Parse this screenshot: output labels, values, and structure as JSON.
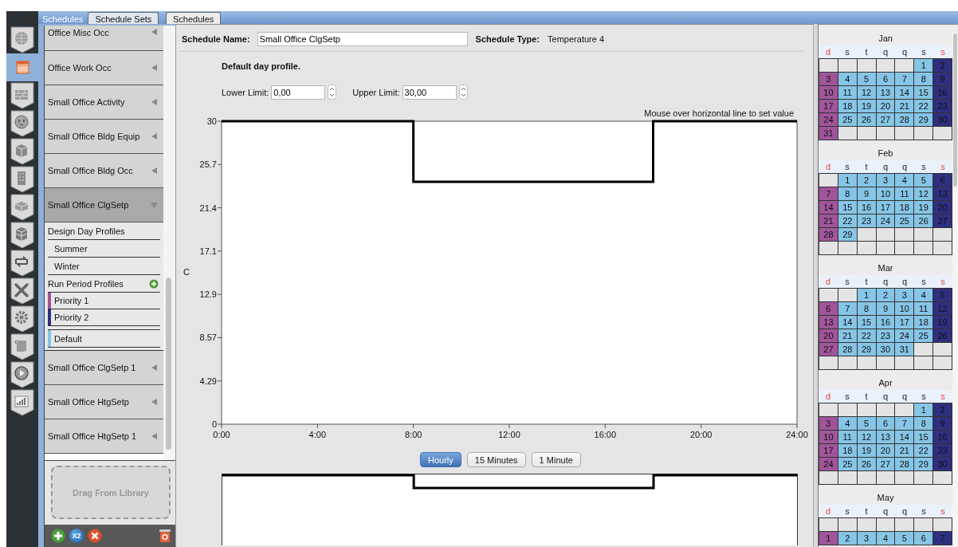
{
  "nav_items": [
    {
      "selected": false
    },
    {
      "selected": true
    },
    {
      "selected": false
    },
    {
      "selected": false
    },
    {
      "selected": false
    },
    {
      "selected": false
    },
    {
      "selected": false
    },
    {
      "selected": false
    },
    {
      "selected": false
    },
    {
      "selected": false
    },
    {
      "selected": false
    },
    {
      "selected": false
    },
    {
      "selected": false
    },
    {
      "selected": false
    }
  ],
  "library_tabs": [
    {
      "label": "Schedules",
      "selected": true
    },
    {
      "label": "Schedule Sets",
      "selected": false
    }
  ],
  "main_tabs": [
    {
      "label": "Schedules",
      "selected": true
    }
  ],
  "schedules": [
    {
      "label": "Office Misc Occ",
      "expanded": false
    },
    {
      "label": "Office Work Occ",
      "expanded": false
    },
    {
      "label": "Small Office Activity",
      "expanded": false
    },
    {
      "label": "Small Office Bldg Equip",
      "expanded": false
    },
    {
      "label": "Small Office Bldg Occ",
      "expanded": false
    },
    {
      "label": "Small Office ClgSetp",
      "expanded": true,
      "design_day_profiles": {
        "title": "Design Day Profiles",
        "items": [
          {
            "label": "Summer"
          },
          {
            "label": "Winter"
          }
        ]
      },
      "run_period_profiles": {
        "title": "Run Period Profiles",
        "items": [
          {
            "label": "Priority 1",
            "kind": "rule",
            "color": "#a0559b"
          },
          {
            "label": "Priority 2",
            "kind": "rule",
            "color": "#2e2f7f"
          },
          {
            "label": "Default",
            "kind": "default",
            "color": "#86c5e6"
          }
        ]
      }
    },
    {
      "label": "Small Office ClgSetp 1",
      "expanded": false
    },
    {
      "label": "Small Office HtgSetp",
      "expanded": false
    },
    {
      "label": "Small Office HtgSetp 1",
      "expanded": false
    }
  ],
  "drag_area": {
    "label": "Drag From Library"
  },
  "library_toolbar": {
    "duplicate_label": "X2"
  },
  "schedule_name": {
    "label": "Schedule Name:",
    "value": "Small Office ClgSetp"
  },
  "schedule_type": {
    "label": "Schedule Type:",
    "value": "Temperature 4"
  },
  "day_profile_title": "Default day profile.",
  "lower_limit": {
    "label": "Lower Limit:",
    "value": "0,00"
  },
  "upper_limit": {
    "label": "Upper Limit:",
    "value": "30,00"
  },
  "chart_hint": "Mouse over horizontal line to set value",
  "chart_data": {
    "type": "line",
    "ylabel": "C",
    "x": [
      0,
      8,
      8,
      18,
      18,
      24
    ],
    "series": [
      {
        "color": "#000000",
        "values": [
          30,
          30,
          24,
          24,
          30,
          30
        ]
      }
    ],
    "xlim": [
      0,
      24
    ],
    "ylim": [
      0,
      30
    ],
    "xticks": [
      {
        "value": 0,
        "label": "0:00"
      },
      {
        "value": 4,
        "label": "4:00"
      },
      {
        "value": 8,
        "label": "8:00"
      },
      {
        "value": 12,
        "label": "12:00"
      },
      {
        "value": 16,
        "label": "16:00"
      },
      {
        "value": 20,
        "label": "20:00"
      },
      {
        "value": 24,
        "label": "24:00"
      }
    ],
    "yticks": [
      0,
      {
        "value": 4.2857,
        "label": "4.29"
      },
      {
        "value": 8.5714,
        "label": "8.57"
      },
      {
        "value": 12.857,
        "label": "12.9"
      },
      {
        "value": 17.143,
        "label": "17.1"
      },
      {
        "value": 21.429,
        "label": "21.4"
      },
      {
        "value": 25.714,
        "label": "25.7"
      },
      30
    ]
  },
  "resolution_buttons": [
    {
      "label": "Hourly",
      "selected": true
    },
    {
      "label": "15 Minutes",
      "selected": false
    },
    {
      "label": "1 Minute",
      "selected": false
    }
  ],
  "calendar": {
    "months": [
      {
        "name": "Jan",
        "weekdays": [
          {
            "label": "d",
            "weekend": true
          },
          {
            "label": "s",
            "weekend": false
          },
          {
            "label": "t",
            "weekend": false
          },
          {
            "label": "q",
            "weekend": false
          },
          {
            "label": "q",
            "weekend": false
          },
          {
            "label": "s",
            "weekend": false
          },
          {
            "label": "s",
            "weekend": true
          }
        ],
        "weeks": [
          [
            {
              "kind": "blank"
            },
            {
              "kind": "blank"
            },
            {
              "kind": "blank"
            },
            {
              "kind": "blank"
            },
            {
              "kind": "blank"
            },
            {
              "kind": "day",
              "day": "1",
              "color": "#86c5e6"
            },
            {
              "kind": "day",
              "day": "2",
              "color": "#2e2f7f"
            }
          ],
          [
            {
              "kind": "day",
              "day": "3",
              "color": "#a0559b"
            },
            {
              "kind": "day",
              "day": "4",
              "color": "#86c5e6"
            },
            {
              "kind": "day",
              "day": "5",
              "color": "#86c5e6"
            },
            {
              "kind": "day",
              "day": "6",
              "color": "#86c5e6"
            },
            {
              "kind": "day",
              "day": "7",
              "color": "#86c5e6"
            },
            {
              "kind": "day",
              "day": "8",
              "color": "#86c5e6"
            },
            {
              "kind": "day",
              "day": "9",
              "color": "#2e2f7f"
            }
          ],
          [
            {
              "kind": "day",
              "day": "10",
              "color": "#a0559b"
            },
            {
              "kind": "day",
              "day": "11",
              "color": "#86c5e6"
            },
            {
              "kind": "day",
              "day": "12",
              "color": "#86c5e6"
            },
            {
              "kind": "day",
              "day": "13",
              "color": "#86c5e6"
            },
            {
              "kind": "day",
              "day": "14",
              "color": "#86c5e6"
            },
            {
              "kind": "day",
              "day": "15",
              "color": "#86c5e6"
            },
            {
              "kind": "day",
              "day": "16",
              "color": "#2e2f7f"
            }
          ],
          [
            {
              "kind": "day",
              "day": "17",
              "color": "#a0559b"
            },
            {
              "kind": "day",
              "day": "18",
              "color": "#86c5e6"
            },
            {
              "kind": "day",
              "day": "19",
              "color": "#86c5e6"
            },
            {
              "kind": "day",
              "day": "20",
              "color": "#86c5e6"
            },
            {
              "kind": "day",
              "day": "21",
              "color": "#86c5e6"
            },
            {
              "kind": "day",
              "day": "22",
              "color": "#86c5e6"
            },
            {
              "kind": "day",
              "day": "23",
              "color": "#2e2f7f"
            }
          ],
          [
            {
              "kind": "day",
              "day": "24",
              "color": "#a0559b"
            },
            {
              "kind": "day",
              "day": "25",
              "color": "#86c5e6"
            },
            {
              "kind": "day",
              "day": "26",
              "color": "#86c5e6"
            },
            {
              "kind": "day",
              "day": "27",
              "color": "#86c5e6"
            },
            {
              "kind": "day",
              "day": "28",
              "color": "#86c5e6"
            },
            {
              "kind": "day",
              "day": "29",
              "color": "#86c5e6"
            },
            {
              "kind": "day",
              "day": "30",
              "color": "#2e2f7f"
            }
          ],
          [
            {
              "kind": "day",
              "day": "31",
              "color": "#a0559b"
            },
            {
              "kind": "blank"
            },
            {
              "kind": "blank"
            },
            {
              "kind": "blank"
            },
            {
              "kind": "blank"
            },
            {
              "kind": "blank"
            },
            {
              "kind": "blank"
            }
          ]
        ]
      },
      {
        "name": "Feb",
        "weekdays": [
          {
            "label": "d",
            "weekend": true
          },
          {
            "label": "s",
            "weekend": false
          },
          {
            "label": "t",
            "weekend": false
          },
          {
            "label": "q",
            "weekend": false
          },
          {
            "label": "q",
            "weekend": false
          },
          {
            "label": "s",
            "weekend": false
          },
          {
            "label": "s",
            "weekend": true
          }
        ],
        "weeks": [
          [
            {
              "kind": "blank"
            },
            {
              "kind": "day",
              "day": "1",
              "color": "#86c5e6"
            },
            {
              "kind": "day",
              "day": "2",
              "color": "#86c5e6"
            },
            {
              "kind": "day",
              "day": "3",
              "color": "#86c5e6"
            },
            {
              "kind": "day",
              "day": "4",
              "color": "#86c5e6"
            },
            {
              "kind": "day",
              "day": "5",
              "color": "#86c5e6"
            },
            {
              "kind": "day",
              "day": "6",
              "color": "#2e2f7f"
            }
          ],
          [
            {
              "kind": "day",
              "day": "7",
              "color": "#a0559b"
            },
            {
              "kind": "day",
              "day": "8",
              "color": "#86c5e6"
            },
            {
              "kind": "day",
              "day": "9",
              "color": "#86c5e6"
            },
            {
              "kind": "day",
              "day": "10",
              "color": "#86c5e6"
            },
            {
              "kind": "day",
              "day": "11",
              "color": "#86c5e6"
            },
            {
              "kind": "day",
              "day": "12",
              "color": "#86c5e6"
            },
            {
              "kind": "day",
              "day": "13",
              "color": "#2e2f7f"
            }
          ],
          [
            {
              "kind": "day",
              "day": "14",
              "color": "#a0559b"
            },
            {
              "kind": "day",
              "day": "15",
              "color": "#86c5e6"
            },
            {
              "kind": "day",
              "day": "16",
              "color": "#86c5e6"
            },
            {
              "kind": "day",
              "day": "17",
              "color": "#86c5e6"
            },
            {
              "kind": "day",
              "day": "18",
              "color": "#86c5e6"
            },
            {
              "kind": "day",
              "day": "19",
              "color": "#86c5e6"
            },
            {
              "kind": "day",
              "day": "20",
              "color": "#2e2f7f"
            }
          ],
          [
            {
              "kind": "day",
              "day": "21",
              "color": "#a0559b"
            },
            {
              "kind": "day",
              "day": "22",
              "color": "#86c5e6"
            },
            {
              "kind": "day",
              "day": "23",
              "color": "#86c5e6"
            },
            {
              "kind": "day",
              "day": "24",
              "color": "#86c5e6"
            },
            {
              "kind": "day",
              "day": "25",
              "color": "#86c5e6"
            },
            {
              "kind": "day",
              "day": "26",
              "color": "#86c5e6"
            },
            {
              "kind": "day",
              "day": "27",
              "color": "#2e2f7f"
            }
          ],
          [
            {
              "kind": "day",
              "day": "28",
              "color": "#a0559b"
            },
            {
              "kind": "day",
              "day": "29",
              "color": "#86c5e6"
            },
            {
              "kind": "blank"
            },
            {
              "kind": "blank"
            },
            {
              "kind": "blank"
            },
            {
              "kind": "blank"
            },
            {
              "kind": "blank"
            }
          ],
          [
            {
              "kind": "blank"
            },
            {
              "kind": "blank"
            },
            {
              "kind": "blank"
            },
            {
              "kind": "blank"
            },
            {
              "kind": "blank"
            },
            {
              "kind": "blank"
            },
            {
              "kind": "blank"
            }
          ]
        ]
      },
      {
        "name": "Mar",
        "weekdays": [
          {
            "label": "d",
            "weekend": true
          },
          {
            "label": "s",
            "weekend": false
          },
          {
            "label": "t",
            "weekend": false
          },
          {
            "label": "q",
            "weekend": false
          },
          {
            "label": "q",
            "weekend": false
          },
          {
            "label": "s",
            "weekend": false
          },
          {
            "label": "s",
            "weekend": true
          }
        ],
        "weeks": [
          [
            {
              "kind": "blank"
            },
            {
              "kind": "blank"
            },
            {
              "kind": "day",
              "day": "1",
              "color": "#86c5e6"
            },
            {
              "kind": "day",
              "day": "2",
              "color": "#86c5e6"
            },
            {
              "kind": "day",
              "day": "3",
              "color": "#86c5e6"
            },
            {
              "kind": "day",
              "day": "4",
              "color": "#86c5e6"
            },
            {
              "kind": "day",
              "day": "5",
              "color": "#2e2f7f"
            }
          ],
          [
            {
              "kind": "day",
              "day": "6",
              "color": "#a0559b"
            },
            {
              "kind": "day",
              "day": "7",
              "color": "#86c5e6"
            },
            {
              "kind": "day",
              "day": "8",
              "color": "#86c5e6"
            },
            {
              "kind": "day",
              "day": "9",
              "color": "#86c5e6"
            },
            {
              "kind": "day",
              "day": "10",
              "color": "#86c5e6"
            },
            {
              "kind": "day",
              "day": "11",
              "color": "#86c5e6"
            },
            {
              "kind": "day",
              "day": "12",
              "color": "#2e2f7f"
            }
          ],
          [
            {
              "kind": "day",
              "day": "13",
              "color": "#a0559b"
            },
            {
              "kind": "day",
              "day": "14",
              "color": "#86c5e6"
            },
            {
              "kind": "day",
              "day": "15",
              "color": "#86c5e6"
            },
            {
              "kind": "day",
              "day": "16",
              "color": "#86c5e6"
            },
            {
              "kind": "day",
              "day": "17",
              "color": "#86c5e6"
            },
            {
              "kind": "day",
              "day": "18",
              "color": "#86c5e6"
            },
            {
              "kind": "day",
              "day": "19",
              "color": "#2e2f7f"
            }
          ],
          [
            {
              "kind": "day",
              "day": "20",
              "color": "#a0559b"
            },
            {
              "kind": "day",
              "day": "21",
              "color": "#86c5e6"
            },
            {
              "kind": "day",
              "day": "22",
              "color": "#86c5e6"
            },
            {
              "kind": "day",
              "day": "23",
              "color": "#86c5e6"
            },
            {
              "kind": "day",
              "day": "24",
              "color": "#86c5e6"
            },
            {
              "kind": "day",
              "day": "25",
              "color": "#86c5e6"
            },
            {
              "kind": "day",
              "day": "26",
              "color": "#2e2f7f"
            }
          ],
          [
            {
              "kind": "day",
              "day": "27",
              "color": "#a0559b"
            },
            {
              "kind": "day",
              "day": "28",
              "color": "#86c5e6"
            },
            {
              "kind": "day",
              "day": "29",
              "color": "#86c5e6"
            },
            {
              "kind": "day",
              "day": "30",
              "color": "#86c5e6"
            },
            {
              "kind": "day",
              "day": "31",
              "color": "#86c5e6"
            },
            {
              "kind": "blank"
            },
            {
              "kind": "blank"
            }
          ],
          [
            {
              "kind": "blank"
            },
            {
              "kind": "blank"
            },
            {
              "kind": "blank"
            },
            {
              "kind": "blank"
            },
            {
              "kind": "blank"
            },
            {
              "kind": "blank"
            },
            {
              "kind": "blank"
            }
          ]
        ]
      },
      {
        "name": "Apr",
        "weekdays": [
          {
            "label": "d",
            "weekend": true
          },
          {
            "label": "s",
            "weekend": false
          },
          {
            "label": "t",
            "weekend": false
          },
          {
            "label": "q",
            "weekend": false
          },
          {
            "label": "q",
            "weekend": false
          },
          {
            "label": "s",
            "weekend": false
          },
          {
            "label": "s",
            "weekend": true
          }
        ],
        "weeks": [
          [
            {
              "kind": "blank"
            },
            {
              "kind": "blank"
            },
            {
              "kind": "blank"
            },
            {
              "kind": "blank"
            },
            {
              "kind": "blank"
            },
            {
              "kind": "day",
              "day": "1",
              "color": "#86c5e6"
            },
            {
              "kind": "day",
              "day": "2",
              "color": "#2e2f7f"
            }
          ],
          [
            {
              "kind": "day",
              "day": "3",
              "color": "#a0559b"
            },
            {
              "kind": "day",
              "day": "4",
              "color": "#86c5e6"
            },
            {
              "kind": "day",
              "day": "5",
              "color": "#86c5e6"
            },
            {
              "kind": "day",
              "day": "6",
              "color": "#86c5e6"
            },
            {
              "kind": "day",
              "day": "7",
              "color": "#86c5e6"
            },
            {
              "kind": "day",
              "day": "8",
              "color": "#86c5e6"
            },
            {
              "kind": "day",
              "day": "9",
              "color": "#2e2f7f"
            }
          ],
          [
            {
              "kind": "day",
              "day": "10",
              "color": "#a0559b"
            },
            {
              "kind": "day",
              "day": "11",
              "color": "#86c5e6"
            },
            {
              "kind": "day",
              "day": "12",
              "color": "#86c5e6"
            },
            {
              "kind": "day",
              "day": "13",
              "color": "#86c5e6"
            },
            {
              "kind": "day",
              "day": "14",
              "color": "#86c5e6"
            },
            {
              "kind": "day",
              "day": "15",
              "color": "#86c5e6"
            },
            {
              "kind": "day",
              "day": "16",
              "color": "#2e2f7f"
            }
          ],
          [
            {
              "kind": "day",
              "day": "17",
              "color": "#a0559b"
            },
            {
              "kind": "day",
              "day": "18",
              "color": "#86c5e6"
            },
            {
              "kind": "day",
              "day": "19",
              "color": "#86c5e6"
            },
            {
              "kind": "day",
              "day": "20",
              "color": "#86c5e6"
            },
            {
              "kind": "day",
              "day": "21",
              "color": "#86c5e6"
            },
            {
              "kind": "day",
              "day": "22",
              "color": "#86c5e6"
            },
            {
              "kind": "day",
              "day": "23",
              "color": "#2e2f7f"
            }
          ],
          [
            {
              "kind": "day",
              "day": "24",
              "color": "#a0559b"
            },
            {
              "kind": "day",
              "day": "25",
              "color": "#86c5e6"
            },
            {
              "kind": "day",
              "day": "26",
              "color": "#86c5e6"
            },
            {
              "kind": "day",
              "day": "27",
              "color": "#86c5e6"
            },
            {
              "kind": "day",
              "day": "28",
              "color": "#86c5e6"
            },
            {
              "kind": "day",
              "day": "29",
              "color": "#86c5e6"
            },
            {
              "kind": "day",
              "day": "30",
              "color": "#2e2f7f"
            }
          ],
          [
            {
              "kind": "blank"
            },
            {
              "kind": "blank"
            },
            {
              "kind": "blank"
            },
            {
              "kind": "blank"
            },
            {
              "kind": "blank"
            },
            {
              "kind": "blank"
            },
            {
              "kind": "blank"
            }
          ]
        ]
      },
      {
        "name": "May",
        "weekdays": [
          {
            "label": "d",
            "weekend": true
          },
          {
            "label": "s",
            "weekend": false
          },
          {
            "label": "t",
            "weekend": false
          },
          {
            "label": "q",
            "weekend": false
          },
          {
            "label": "q",
            "weekend": false
          },
          {
            "label": "s",
            "weekend": false
          },
          {
            "label": "s",
            "weekend": true
          }
        ],
        "weeks": [
          [
            {
              "kind": "blank"
            },
            {
              "kind": "blank"
            },
            {
              "kind": "blank"
            },
            {
              "kind": "blank"
            },
            {
              "kind": "blank"
            },
            {
              "kind": "blank"
            },
            {
              "kind": "blank"
            }
          ],
          [
            {
              "kind": "day",
              "day": "1",
              "color": "#a0559b"
            },
            {
              "kind": "day",
              "day": "2",
              "color": "#86c5e6"
            },
            {
              "kind": "day",
              "day": "3",
              "color": "#86c5e6"
            },
            {
              "kind": "day",
              "day": "4",
              "color": "#86c5e6"
            },
            {
              "kind": "day",
              "day": "5",
              "color": "#86c5e6"
            },
            {
              "kind": "day",
              "day": "6",
              "color": "#86c5e6"
            },
            {
              "kind": "day",
              "day": "7",
              "color": "#2e2f7f"
            }
          ]
        ]
      }
    ]
  }
}
